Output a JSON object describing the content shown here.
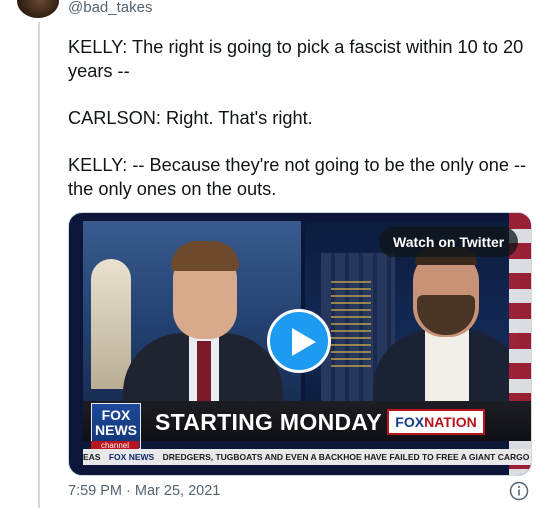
{
  "author": {
    "handle": "@bad_takes"
  },
  "tweet": {
    "paragraphs": [
      "KELLY: The right is going to pick a fascist within 10 to 20 years --",
      "CARLSON: Right. That's right.",
      "KELLY: -- Because they're not going to be the only one -- the only ones on the outs."
    ],
    "timestamp": "7:59 PM · Mar 25, 2021"
  },
  "media": {
    "watch_label": "Watch on Twitter",
    "logo_line1": "FOX",
    "logo_line2": "NEWS",
    "logo_channel": "channel",
    "headline": "STARTING MONDAY",
    "foxnation_fox": "FOX",
    "foxnation_nation": "NATION",
    "ticker_left": "EAS",
    "ticker_brand": "FOX NEWS",
    "ticker_text": "DREDGERS, TUGBOATS AND EVEN A BACKHOE HAVE FAILED TO FREE A GIANT CARGO"
  },
  "colors": {
    "accent": "#1d9bf0",
    "text": "#0f1419",
    "muted": "#536471",
    "border": "#cfd9de"
  },
  "icons": {
    "play": "play-icon",
    "info": "info-icon"
  }
}
